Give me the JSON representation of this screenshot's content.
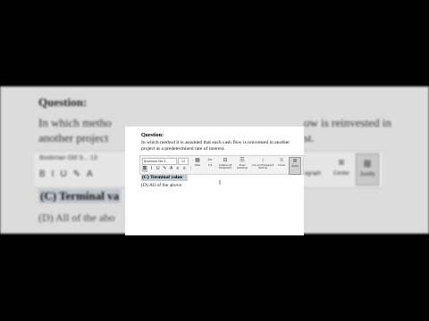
{
  "background": {
    "question_label": "Question:",
    "line1_left": "In which metho",
    "line1_right": "ow is reinvested in",
    "line2_left": "another project",
    "line2_right": "st.",
    "font_name": "Bookman Old S... 13",
    "format_glyphs": "BIU✎A",
    "buttons": [
      {
        "label": "agraph",
        "glyph": ""
      },
      {
        "label": "Center",
        "glyph": "≡"
      },
      {
        "label": "Justify",
        "glyph": "≣"
      }
    ],
    "selected": "(C) Terminal va",
    "option_d": "(D) All of the abo"
  },
  "card": {
    "question_label": "Question:",
    "question_text": "In which method it is assumed that each cash flow is reinvested in another project at a predetermined rate of interest.",
    "toolbar": {
      "font_select": "Bookman Old S...",
      "size_select": "13",
      "format_buttons": [
        "B",
        "I",
        "U",
        "✎",
        "A",
        "≡",
        "≡",
        "⋮"
      ],
      "buttons": [
        {
          "label": "Table",
          "glyph": "▦"
        },
        {
          "label": "Cut",
          "glyph": "✂"
        },
        {
          "label": "Collapse All Paragraphs",
          "glyph": "⊟"
        },
        {
          "label": "Show Headings",
          "glyph": "☰"
        },
        {
          "label": "Line and Paragraph Spacing",
          "glyph": "↕"
        },
        {
          "label": "Center",
          "glyph": "≡"
        },
        {
          "label": "Justify",
          "glyph": "≣"
        }
      ]
    },
    "option_c": "(C) Terminal value",
    "option_d": "(D) All of the above"
  }
}
